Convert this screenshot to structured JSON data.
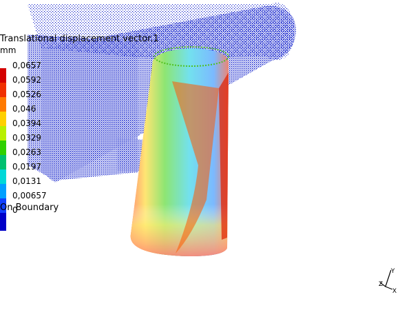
{
  "legend": {
    "title": "Translational displacement vector.1",
    "unit": "mm",
    "ticks": [
      "0,0657",
      "0,0592",
      "0,0526",
      "0,046",
      "0,0394",
      "0,0329",
      "0,0263",
      "0,0197",
      "0,0131",
      "0,00657",
      "0"
    ],
    "boundary_label": "On Boundary",
    "colors": [
      "#d40000",
      "#f03000",
      "#ff7a00",
      "#ffd000",
      "#b8f000",
      "#2fd000",
      "#00c070",
      "#00d8d8",
      "#00a0ff",
      "#1040ff",
      "#0000c8"
    ]
  },
  "axis": {
    "y_label": "Y",
    "z_label": "Z",
    "x_label": "X"
  },
  "colors": {
    "mesh_blue": "#0010c8",
    "background": "#ffffff"
  }
}
